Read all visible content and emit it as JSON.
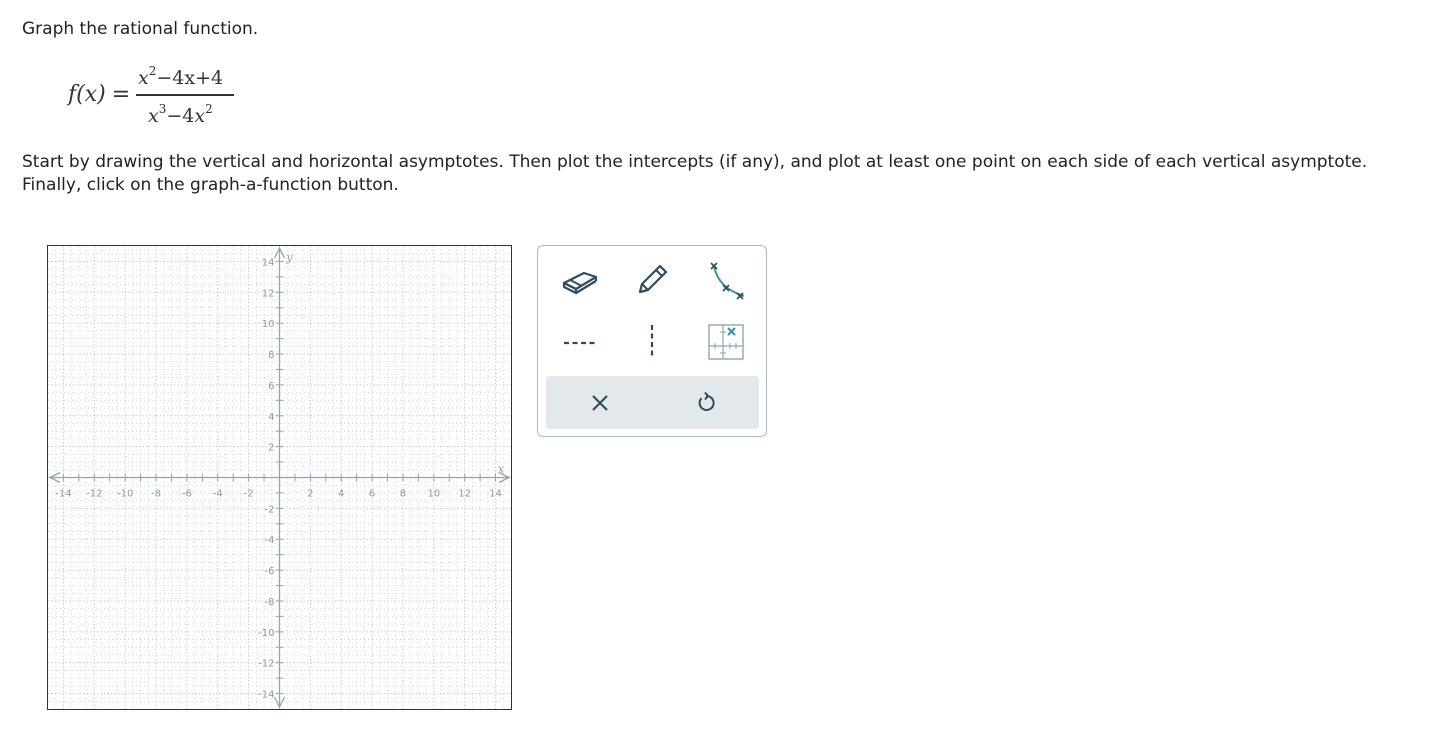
{
  "prompt": "Graph the rational function.",
  "function": {
    "name": "f",
    "variable": "x",
    "numerator": {
      "t1_base": "x",
      "t1_exp": "2",
      "rest": "−4x+4"
    },
    "denominator": {
      "t1_base": "x",
      "t1_exp": "3",
      "minus": "−4",
      "t2_base": "x",
      "t2_exp": "2"
    }
  },
  "instructions": {
    "line1": "Start by drawing the vertical and horizontal asymptotes. Then plot the intercepts (if any), and plot at least one point on each side of each vertical asymptote.",
    "line2": "Finally, click on the graph-a-function button."
  },
  "graph": {
    "xmin": -15,
    "xmax": 15,
    "ymin": -15,
    "ymax": 15,
    "x_axis_label": "x",
    "y_axis_label": "y",
    "x_tick_labels": [
      "-14",
      "-12",
      "-10",
      "-8",
      "-6",
      "-4",
      "-2",
      "2",
      "4",
      "6",
      "8",
      "10",
      "12",
      "14"
    ],
    "y_tick_labels": [
      "14",
      "12",
      "10",
      "8",
      "6",
      "4",
      "2",
      "-2",
      "-4",
      "-6",
      "-8",
      "-10",
      "-12",
      "-14"
    ],
    "grid_color": "#c6cdd3",
    "axis_color": "#8aa7b6"
  },
  "toolbox": {
    "tools": [
      "eraser-icon",
      "pencil-icon",
      "curve-graph-icon",
      "horizontal-asymptote-icon",
      "vertical-asymptote-icon",
      "points-grid-icon"
    ],
    "actions": [
      "clear-icon",
      "undo-icon"
    ],
    "accent_color": "#3a8fa8",
    "icon_color": "#2e4d5c"
  }
}
